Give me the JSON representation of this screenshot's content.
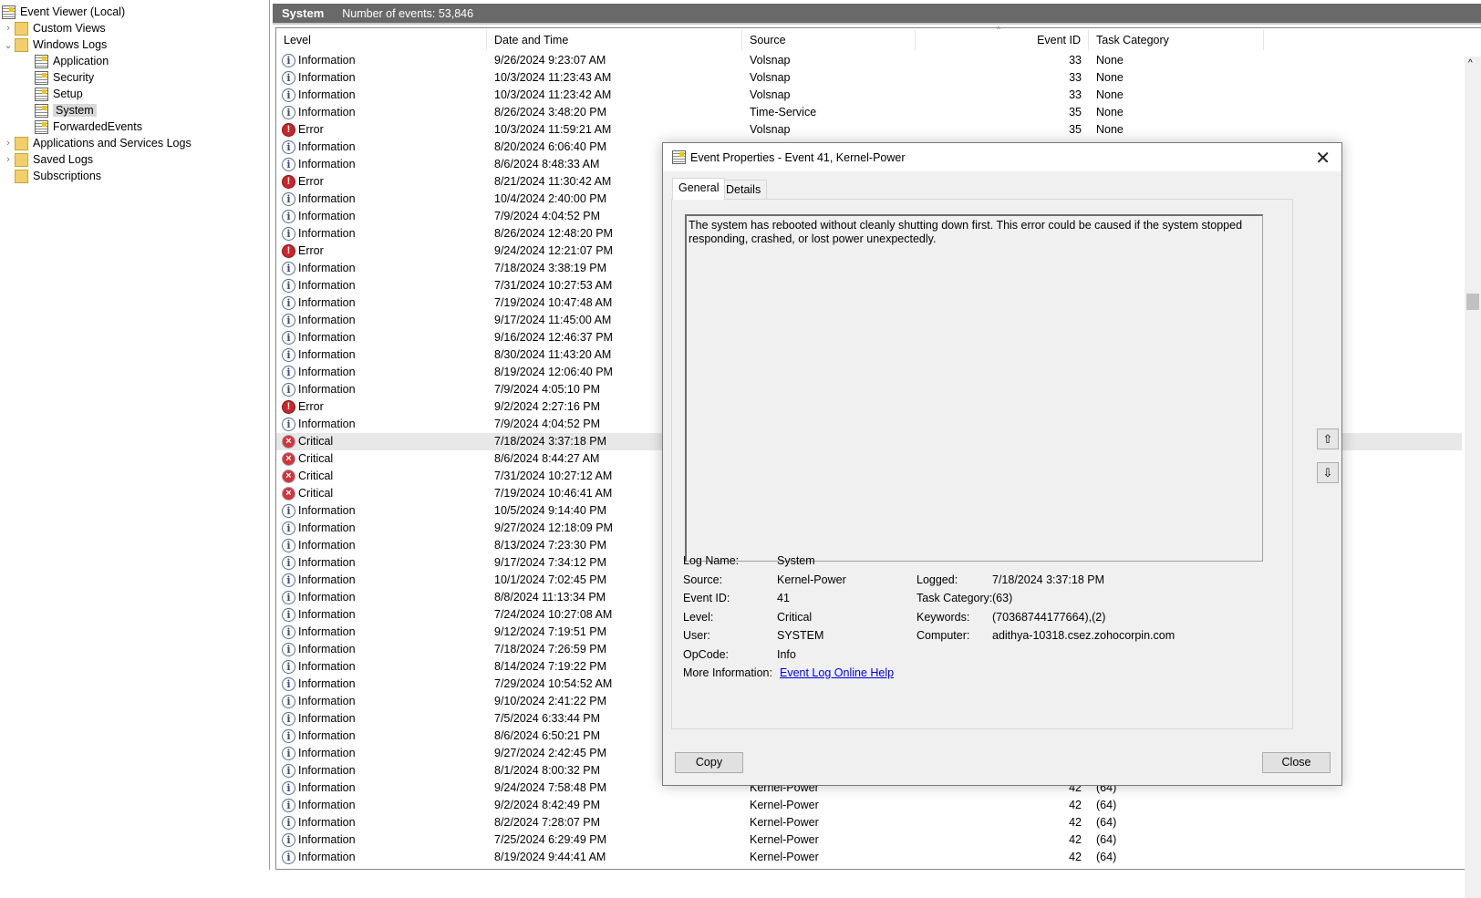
{
  "tree": {
    "root": "Event Viewer (Local)",
    "items": [
      {
        "label": "Custom Views",
        "level": 1,
        "icon": "folder-filter-icon",
        "expander": ">"
      },
      {
        "label": "Windows Logs",
        "level": 1,
        "icon": "folder-icon",
        "expander": "v"
      },
      {
        "label": "Application",
        "level": 2,
        "icon": "log-icon"
      },
      {
        "label": "Security",
        "level": 2,
        "icon": "log-icon"
      },
      {
        "label": "Setup",
        "level": 2,
        "icon": "log-icon"
      },
      {
        "label": "System",
        "level": 2,
        "icon": "log-icon",
        "selected": true
      },
      {
        "label": "ForwardedEvents",
        "level": 2,
        "icon": "log-icon"
      },
      {
        "label": "Applications and Services Logs",
        "level": 1,
        "icon": "folder-icon",
        "expander": ">"
      },
      {
        "label": "Saved Logs",
        "level": 1,
        "icon": "folder-icon",
        "expander": ">"
      },
      {
        "label": "Subscriptions",
        "level": 1,
        "icon": "subscriptions-icon"
      }
    ]
  },
  "header": {
    "title": "System",
    "count": "Number of events: 53,846"
  },
  "columns": [
    "Level",
    "Date and Time",
    "Source",
    "Event ID",
    "Task Category"
  ],
  "rows": [
    [
      "Information",
      "9/26/2024 9:23:07 AM",
      "Volsnap",
      "33",
      "None"
    ],
    [
      "Information",
      "10/3/2024 11:23:43 AM",
      "Volsnap",
      "33",
      "None"
    ],
    [
      "Information",
      "10/3/2024 11:23:42 AM",
      "Volsnap",
      "33",
      "None"
    ],
    [
      "Information",
      "8/26/2024 3:48:20 PM",
      "Time-Service",
      "35",
      "None"
    ],
    [
      "Error",
      "10/3/2024 11:59:21 AM",
      "Volsnap",
      "35",
      "None"
    ],
    [
      "Information",
      "8/20/2024 6:06:40 PM",
      "",
      "",
      ""
    ],
    [
      "Information",
      "8/6/2024 8:48:33 AM",
      "",
      "",
      ""
    ],
    [
      "Error",
      "8/21/2024 11:30:42 AM",
      "",
      "",
      ""
    ],
    [
      "Information",
      "10/4/2024 2:40:00 PM",
      "",
      "",
      ""
    ],
    [
      "Information",
      "7/9/2024 4:04:52 PM",
      "",
      "",
      ""
    ],
    [
      "Information",
      "8/26/2024 12:48:20 PM",
      "",
      "",
      ""
    ],
    [
      "Error",
      "9/24/2024 12:21:07 PM",
      "",
      "",
      ""
    ],
    [
      "Information",
      "7/18/2024 3:38:19 PM",
      "",
      "",
      ""
    ],
    [
      "Information",
      "7/31/2024 10:27:53 AM",
      "",
      "",
      ""
    ],
    [
      "Information",
      "7/19/2024 10:47:48 AM",
      "",
      "",
      ""
    ],
    [
      "Information",
      "9/17/2024 11:45:00 AM",
      "",
      "",
      ""
    ],
    [
      "Information",
      "9/16/2024 12:46:37 PM",
      "",
      "",
      ""
    ],
    [
      "Information",
      "8/30/2024 11:43:20 AM",
      "",
      "",
      ""
    ],
    [
      "Information",
      "8/19/2024 12:06:40 PM",
      "",
      "",
      ""
    ],
    [
      "Information",
      "7/9/2024 4:05:10 PM",
      "",
      "",
      ""
    ],
    [
      "Error",
      "9/2/2024 2:27:16 PM",
      "",
      "",
      ""
    ],
    [
      "Information",
      "7/9/2024 4:04:52 PM",
      "",
      "",
      ""
    ],
    [
      "Critical",
      "7/18/2024 3:37:18 PM",
      "",
      "",
      ""
    ],
    [
      "Critical",
      "8/6/2024 8:44:27 AM",
      "",
      "",
      ""
    ],
    [
      "Critical",
      "7/31/2024 10:27:12 AM",
      "",
      "",
      ""
    ],
    [
      "Critical",
      "7/19/2024 10:46:41 AM",
      "",
      "",
      ""
    ],
    [
      "Information",
      "10/5/2024 9:14:40 PM",
      "",
      "",
      ""
    ],
    [
      "Information",
      "9/27/2024 12:18:09 PM",
      "",
      "",
      ""
    ],
    [
      "Information",
      "8/13/2024 7:23:30 PM",
      "",
      "",
      ""
    ],
    [
      "Information",
      "9/17/2024 7:34:12 PM",
      "",
      "",
      ""
    ],
    [
      "Information",
      "10/1/2024 7:02:45 PM",
      "",
      "",
      ""
    ],
    [
      "Information",
      "8/8/2024 11:13:34 PM",
      "",
      "",
      ""
    ],
    [
      "Information",
      "7/24/2024 10:27:08 AM",
      "",
      "",
      ""
    ],
    [
      "Information",
      "9/12/2024 7:19:51 PM",
      "",
      "",
      ""
    ],
    [
      "Information",
      "7/18/2024 7:26:59 PM",
      "",
      "",
      ""
    ],
    [
      "Information",
      "8/14/2024 7:19:22 PM",
      "",
      "",
      ""
    ],
    [
      "Information",
      "7/29/2024 10:54:52 AM",
      "",
      "",
      ""
    ],
    [
      "Information",
      "9/10/2024 2:41:22 PM",
      "",
      "",
      ""
    ],
    [
      "Information",
      "7/5/2024 6:33:44 PM",
      "",
      "",
      ""
    ],
    [
      "Information",
      "8/6/2024 6:50:21 PM",
      "",
      "",
      ""
    ],
    [
      "Information",
      "9/27/2024 2:42:45 PM",
      "",
      "",
      ""
    ],
    [
      "Information",
      "8/1/2024 8:00:32 PM",
      "",
      "",
      ""
    ],
    [
      "Information",
      "9/24/2024 7:58:48 PM",
      "Kernel-Power",
      "42",
      "(64)"
    ],
    [
      "Information",
      "9/2/2024 8:42:49 PM",
      "Kernel-Power",
      "42",
      "(64)"
    ],
    [
      "Information",
      "8/2/2024 7:28:07 PM",
      "Kernel-Power",
      "42",
      "(64)"
    ],
    [
      "Information",
      "7/25/2024 6:29:49 PM",
      "Kernel-Power",
      "42",
      "(64)"
    ],
    [
      "Information",
      "8/19/2024 9:44:41 AM",
      "Kernel-Power",
      "42",
      "(64)"
    ]
  ],
  "selected_row": 22,
  "dialog": {
    "title": "Event Properties - Event 41, Kernel-Power",
    "tabs": [
      "General",
      "Details"
    ],
    "active_tab": "General",
    "description": "The system has rebooted without cleanly shutting down first. This error could be caused if the system stopped responding, crashed, or lost power unexpectedly.",
    "fields": {
      "log_name_label": "Log Name:",
      "log_name": "System",
      "source_label": "Source:",
      "source": "Kernel-Power",
      "event_id_label": "Event ID:",
      "event_id": "41",
      "level_label": "Level:",
      "level": "Critical",
      "user_label": "User:",
      "user": "SYSTEM",
      "opcode_label": "OpCode:",
      "opcode": "Info",
      "more_info_label": "More Information:",
      "more_info_link": "Event Log Online Help",
      "logged_label": "Logged:",
      "logged": "7/18/2024 3:37:18 PM",
      "task_category_label": "Task Category:",
      "task_category": "(63)",
      "keywords_label": "Keywords:",
      "keywords": "(70368744177664),(2)",
      "computer_label": "Computer:",
      "computer": "adithya-10318.csez.zohocorpin.com"
    },
    "copy": "Copy",
    "close": "Close",
    "up": "⇧",
    "down": "⇩"
  }
}
